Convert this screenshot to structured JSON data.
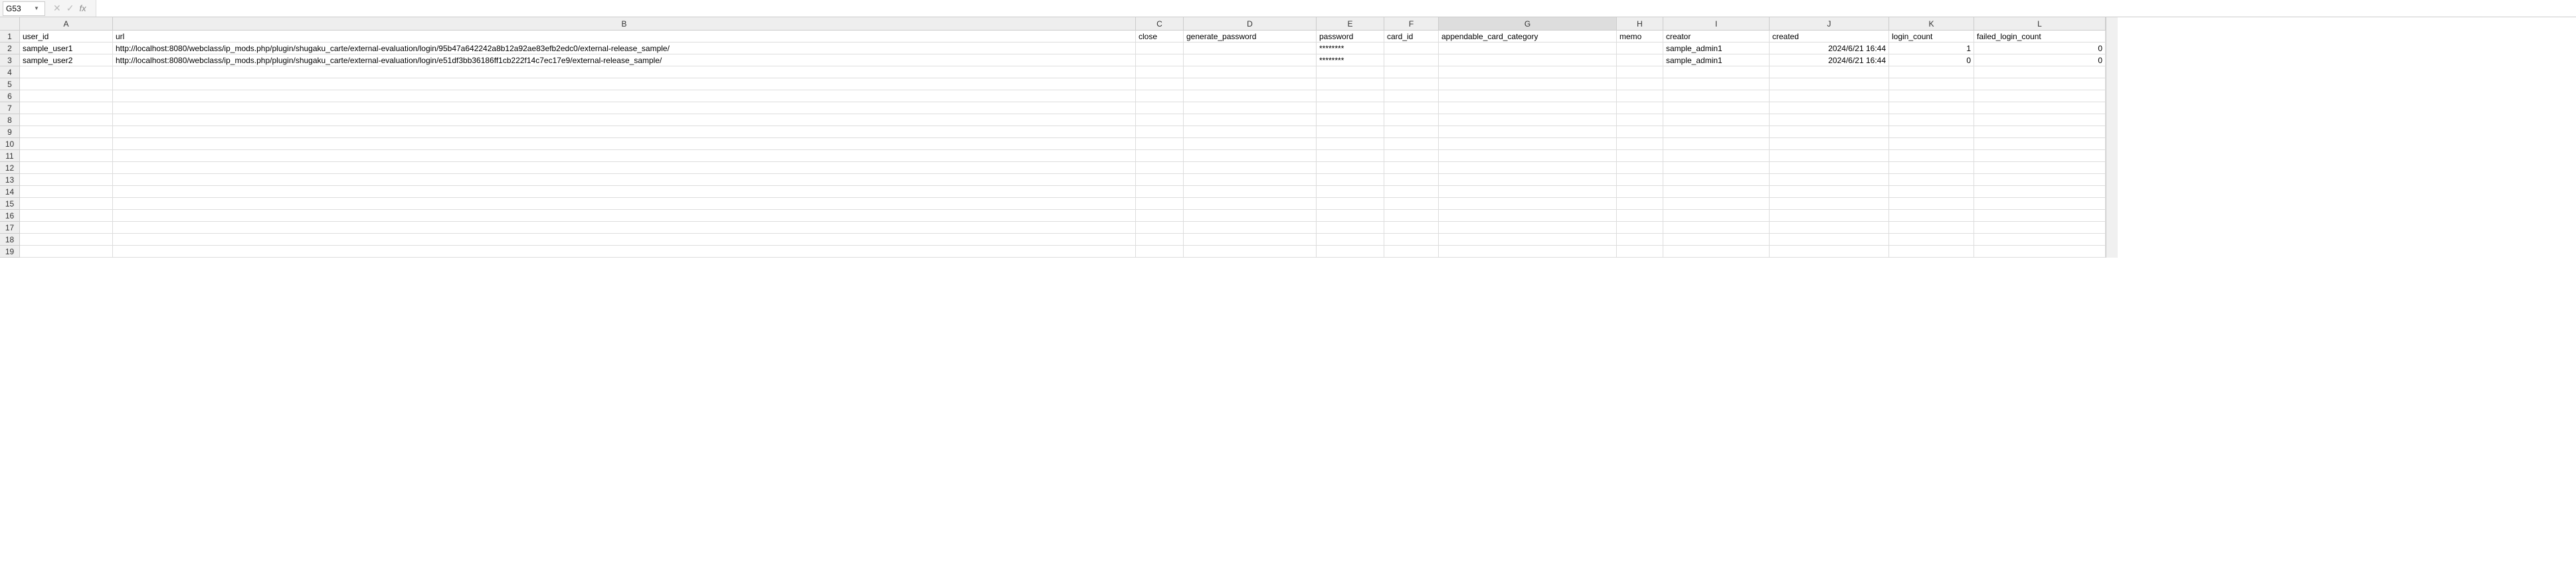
{
  "formula_bar": {
    "name_box": "G53",
    "cancel": "✕",
    "accept": "✓",
    "fx": "fx",
    "input": ""
  },
  "columns": [
    {
      "letter": "A",
      "class": "col-A"
    },
    {
      "letter": "B",
      "class": "col-B"
    },
    {
      "letter": "C",
      "class": "col-C"
    },
    {
      "letter": "D",
      "class": "col-D"
    },
    {
      "letter": "E",
      "class": "col-E"
    },
    {
      "letter": "F",
      "class": "col-F"
    },
    {
      "letter": "G",
      "class": "col-G"
    },
    {
      "letter": "H",
      "class": "col-H"
    },
    {
      "letter": "I",
      "class": "col-I"
    },
    {
      "letter": "J",
      "class": "col-J"
    },
    {
      "letter": "K",
      "class": "col-K"
    },
    {
      "letter": "L",
      "class": "col-L"
    }
  ],
  "headers": {
    "A": "user_id",
    "B": "url",
    "C": "close",
    "D": "generate_password",
    "E": "password",
    "F": "card_id",
    "G": "appendable_card_category",
    "H": "memo",
    "I": "creator",
    "J": "created",
    "K": "login_count",
    "L": "failed_login_count"
  },
  "rows": [
    {
      "A": "sample_user1",
      "B": "http://localhost:8080/webclass/ip_mods.php/plugin/shugaku_carte/external-evaluation/login/95b47a642242a8b12a92ae83efb2edc0/external-release_sample/",
      "C": "",
      "D": "",
      "E": "********",
      "F": "",
      "G": "",
      "H": "",
      "I": "sample_admin1",
      "J": "2024/6/21 16:44",
      "K": "1",
      "L": "0"
    },
    {
      "A": "sample_user2",
      "B": "http://localhost:8080/webclass/ip_mods.php/plugin/shugaku_carte/external-evaluation/login/e51df3bb36186ff1cb222f14c7ec17e9/external-release_sample/",
      "C": "",
      "D": "",
      "E": "********",
      "F": "",
      "G": "",
      "H": "",
      "I": "sample_admin1",
      "J": "2024/6/21 16:44",
      "K": "0",
      "L": "0"
    }
  ],
  "empty_rows": 16,
  "selected_col": "G",
  "numeric_cols": [
    "J",
    "K",
    "L"
  ]
}
